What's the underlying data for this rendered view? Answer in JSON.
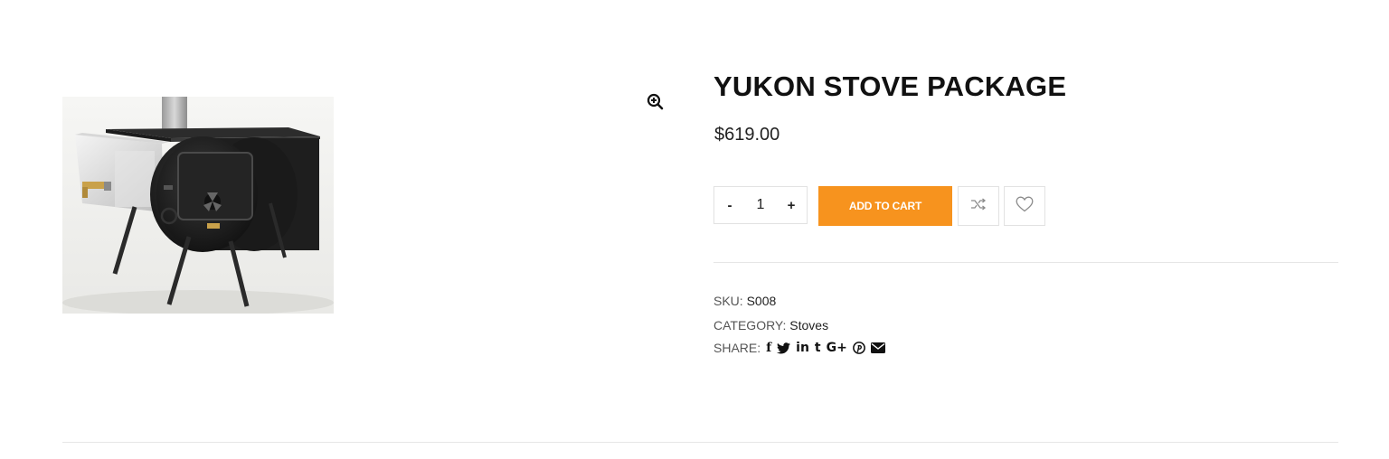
{
  "product": {
    "image_alt": "Yukon stove with water tank on folding legs",
    "title": "YUKON STOVE PACKAGE",
    "price": "$619.00"
  },
  "zoom": {
    "icon": "magnifier-plus-icon"
  },
  "quantity": {
    "minus_label": "-",
    "value": "1",
    "plus_label": "+"
  },
  "actions": {
    "add_to_cart_label": "ADD TO CART",
    "add_to_cart_color": "#f7931e",
    "compare_icon": "shuffle-icon",
    "wishlist_icon": "heart-icon"
  },
  "meta": {
    "sku_label": "SKU:",
    "sku_value": "S008",
    "category_label": "CATEGORY:",
    "category_value": "Stoves",
    "share_label": "SHARE:",
    "share_icons": [
      "facebook-icon",
      "twitter-icon",
      "linkedin-icon",
      "tumblr-icon",
      "google-plus-icon",
      "pinterest-icon",
      "email-icon"
    ]
  },
  "share_glyphs": {
    "facebook": "f",
    "linkedin": "in",
    "tumblr": "t",
    "google_plus": "G+"
  }
}
